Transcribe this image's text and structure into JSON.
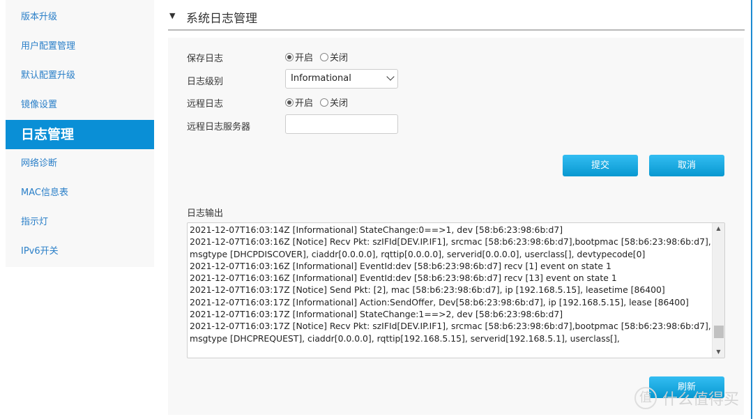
{
  "sidebar": {
    "items": [
      {
        "label": "版本升级"
      },
      {
        "label": "用户配置管理"
      },
      {
        "label": "默认配置升级"
      },
      {
        "label": "镜像设置"
      },
      {
        "label": "日志管理",
        "active": true
      },
      {
        "label": "网络诊断"
      },
      {
        "label": "MAC信息表"
      },
      {
        "label": "指示灯"
      },
      {
        "label": "IPv6开关"
      }
    ]
  },
  "header": {
    "collapse_icon": "triangle-down-icon",
    "title": "系统日志管理"
  },
  "form": {
    "save_log": {
      "label": "保存日志",
      "on_label": "开启",
      "off_label": "关闭",
      "value": "开启"
    },
    "log_level": {
      "label": "日志级别",
      "value": "Informational"
    },
    "remote_log": {
      "label": "远程日志",
      "on_label": "开启",
      "off_label": "关闭",
      "value": "开启"
    },
    "remote_server": {
      "label": "远程日志服务器",
      "value": ""
    },
    "submit_label": "提交",
    "cancel_label": "取消"
  },
  "log_output": {
    "label": "日志输出",
    "lines": [
      "2021-12-07T16:03:14Z [Informational] StateChange:0==>1, dev [58:b6:23:98:6b:d7]",
      "2021-12-07T16:03:16Z [Notice] Recv Pkt: szIFId[DEV.IP.IF1], srcmac [58:b6:23:98:6b:d7],bootpmac [58:b6:23:98:6b:d7],msgtype [DHCPDISCOVER], ciaddr[0.0.0.0], rqttip[0.0.0.0], serverid[0.0.0.0], userclass[], devtypecode[0]",
      "2021-12-07T16:03:16Z [Informational] EventId:dev [58:b6:23:98:6b:d7] recv [1] event on state 1",
      "2021-12-07T16:03:16Z [Informational] EventId:dev [58:b6:23:98:6b:d7] recv [13] event on state 1",
      "2021-12-07T16:03:17Z [Notice] Send Pkt: [2], mac [58:b6:23:98:6b:d7], ip [192.168.5.15], leasetime [86400]",
      "2021-12-07T16:03:17Z [Informational] Action:SendOffer, Dev[58:b6:23:98:6b:d7], ip [192.168.5.15], lease [86400]",
      "2021-12-07T16:03:17Z [Informational] StateChange:1==>2, dev [58:b6:23:98:6b:d7]",
      "2021-12-07T16:03:17Z [Notice] Recv Pkt: szIFId[DEV.IP.IF1], srcmac [58:b6:23:98:6b:d7],bootpmac [58:b6:23:98:6b:d7],msgtype [DHCPREQUEST], ciaddr[0.0.0.0], rqttip[192.168.5.15], serverid[192.168.5.1], userclass[],"
    ],
    "refresh_label": "刷新"
  },
  "watermark": {
    "badge": "值",
    "text": "什么值得买"
  }
}
